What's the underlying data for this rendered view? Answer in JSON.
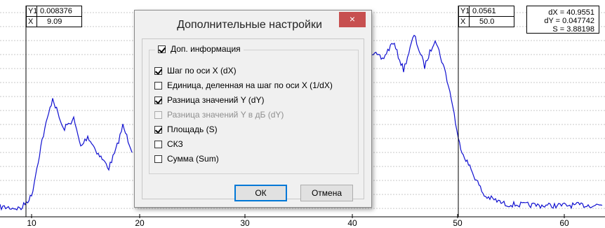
{
  "plot": {
    "background": "#ffffff",
    "grid_color": "#c8c8c8",
    "line_color": "#1010d0",
    "cursor_color": "#000000",
    "x_ticks": [
      "10",
      "20",
      "30",
      "40",
      "50",
      "60"
    ],
    "marker1": {
      "y_label": "Y1",
      "y_value": "0.008376",
      "x_label": "X",
      "x_value": "9.09"
    },
    "marker2": {
      "y_label": "Y1",
      "y_value": "0.0561",
      "x_label": "X",
      "x_value": "50.0"
    },
    "delta": {
      "dx": "dX = 40.9551",
      "dy": "dY = 0.047742",
      "s": "S = 3.88198"
    }
  },
  "dialog": {
    "title": "Дополнительные настройки",
    "close_glyph": "×",
    "group_label": "Доп. информация",
    "group_checked": true,
    "options": [
      {
        "label": "Шаг по оси X (dX)",
        "checked": true,
        "disabled": false
      },
      {
        "label": "Единица, деленная на шаг по оси X (1/dX)",
        "checked": false,
        "disabled": false
      },
      {
        "label": "Разница значений Y (dY)",
        "checked": true,
        "disabled": false
      },
      {
        "label": "Разница значений Y в дБ (dY)",
        "checked": false,
        "disabled": true
      },
      {
        "label": "Площадь (S)",
        "checked": true,
        "disabled": false
      },
      {
        "label": "СКЗ",
        "checked": false,
        "disabled": false
      },
      {
        "label": "Сумма (Sum)",
        "checked": false,
        "disabled": false
      }
    ],
    "ok_label": "ОК",
    "cancel_label": "Отмена"
  }
}
